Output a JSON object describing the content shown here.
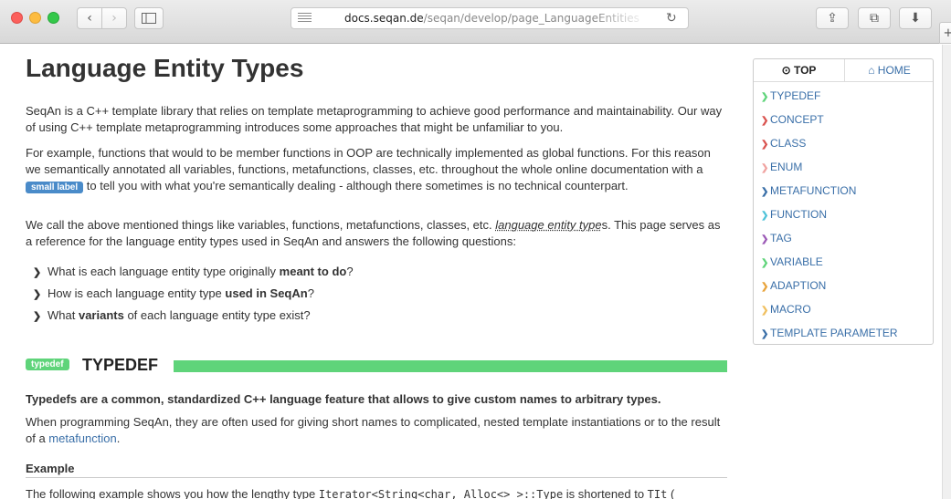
{
  "browser": {
    "url_domain": "docs.seqan.de",
    "url_path": "/seqan/develop/page_LanguageEntities",
    "nav_back_icon": "‹",
    "nav_forward_icon": "›",
    "reload_icon": "↻",
    "share_icon": "⇪",
    "tabs_icon": "⧉",
    "download_icon": "⬇",
    "newtab_icon": "+"
  },
  "page": {
    "title": "Language Entity Types",
    "intro": "SeqAn is a C++ template library that relies on template metaprogramming to achieve good performance and maintainability. Our way of using C++ template metaprogramming introduces some approaches that might be unfamiliar to you.",
    "p2_before": "For example, functions that would to be member functions in OOP are technically implemented as global functions. For this reason we semantically annotated all variables, functions, metafunctions, classes, etc. throughout the whole online documentation with a ",
    "p2_badge": "small label",
    "p2_after": " to tell you with what you're semantically dealing - although there sometimes is no technical counterpart.",
    "p3_before": "We call the above mentioned things like variables, functions, metafunctions, classes, etc. ",
    "p3_link": "language entity type",
    "p3_after": "s. This page serves as a reference for the language entity types used in SeqAn and answers the following questions:",
    "questions": [
      {
        "before": "What is each language entity type originally ",
        "bold": "meant to do",
        "after": "?"
      },
      {
        "before": "How is each language entity type ",
        "bold": "used in SeqAn",
        "after": "?"
      },
      {
        "before": "What ",
        "bold": "variants",
        "after": " of each language entity type exist?"
      }
    ],
    "section": {
      "badge": "typedef",
      "title": "TYPEDEF",
      "lead": "Typedefs are a common, standardized C++ language feature that allows to give custom names to arbitrary types.",
      "p_before": "When programming SeqAn, they are often used for giving short names to complicated, nested template instantiations or to the result of a ",
      "p_link": "metafunction",
      "p_after": ".",
      "example_title": "Example",
      "example_before": "The following example shows you how the lengthy type ",
      "example_code": "Iterator<String<char, Alloc<> >::Type",
      "example_mid": " is shortened to ",
      "example_code2": "TIt",
      "example_after": " ("
    }
  },
  "sidenav": {
    "tab_top": "⊙ TOP",
    "tab_home": "⌂ HOME",
    "items": [
      {
        "label": "TYPEDEF",
        "color": "#5fd47a"
      },
      {
        "label": "CONCEPT",
        "color": "#d9534f"
      },
      {
        "label": "CLASS",
        "color": "#d9534f"
      },
      {
        "label": "ENUM",
        "color": "#f0a3a0"
      },
      {
        "label": "METAFUNCTION",
        "color": "#3a6fa8"
      },
      {
        "label": "FUNCTION",
        "color": "#4fc3d9"
      },
      {
        "label": "TAG",
        "color": "#9b59b6"
      },
      {
        "label": "VARIABLE",
        "color": "#5fd47a"
      },
      {
        "label": "ADAPTION",
        "color": "#e8a33a"
      },
      {
        "label": "MACRO",
        "color": "#f0c060"
      },
      {
        "label": "TEMPLATE PARAMETER",
        "color": "#3a6fa8"
      }
    ]
  }
}
